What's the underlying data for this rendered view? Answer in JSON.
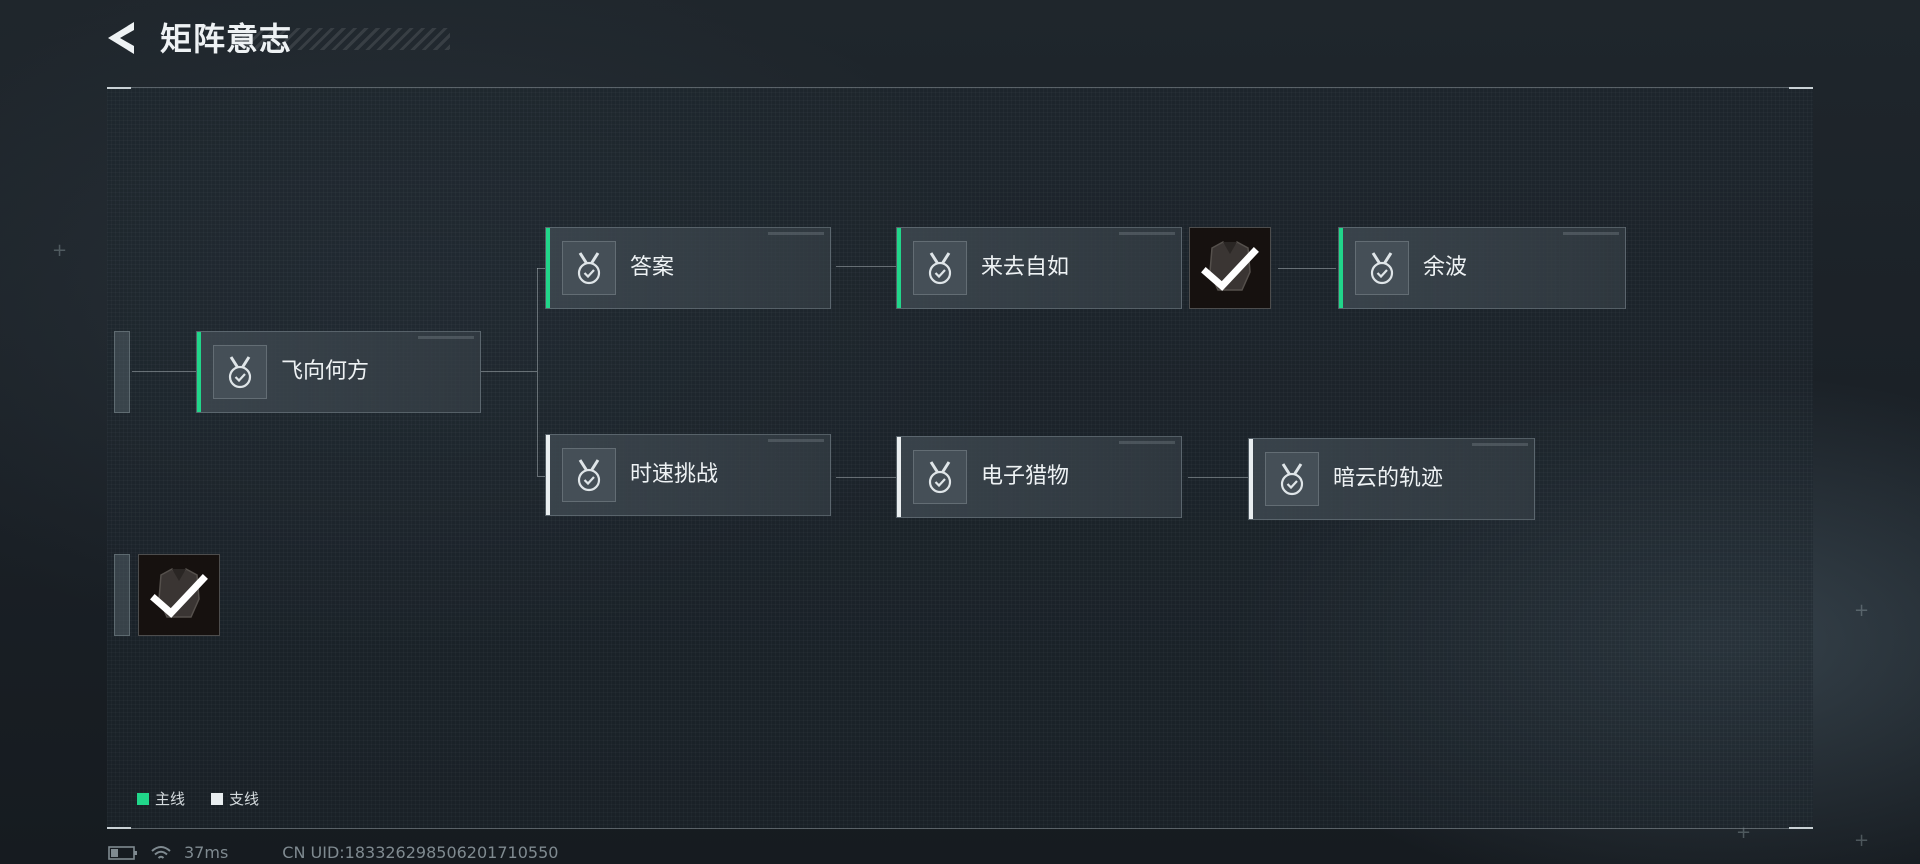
{
  "header": {
    "title": "矩阵意志",
    "back_icon": "back-arrow-icon"
  },
  "nodes": {
    "feixiang": {
      "label": "飞向何方",
      "line": "main"
    },
    "daan": {
      "label": "答案",
      "line": "main"
    },
    "laiqu": {
      "label": "来去自如",
      "line": "main"
    },
    "yubo": {
      "label": "余波",
      "line": "main"
    },
    "shisu": {
      "label": "时速挑战",
      "line": "branch"
    },
    "dianzi": {
      "label": "电子猎物",
      "line": "branch"
    },
    "anyun": {
      "label": "暗云的轨迹",
      "line": "branch"
    }
  },
  "rewards": [
    {
      "name": "armor-reward",
      "claimed": true
    },
    {
      "name": "armor-reward",
      "claimed": true
    }
  ],
  "legend": {
    "main_label": "主线",
    "branch_label": "支线"
  },
  "colors": {
    "main": "#21d68a",
    "branch": "#e9eef0"
  },
  "status": {
    "ping": "37ms",
    "uid": "CN UID:183326298506201710550"
  }
}
